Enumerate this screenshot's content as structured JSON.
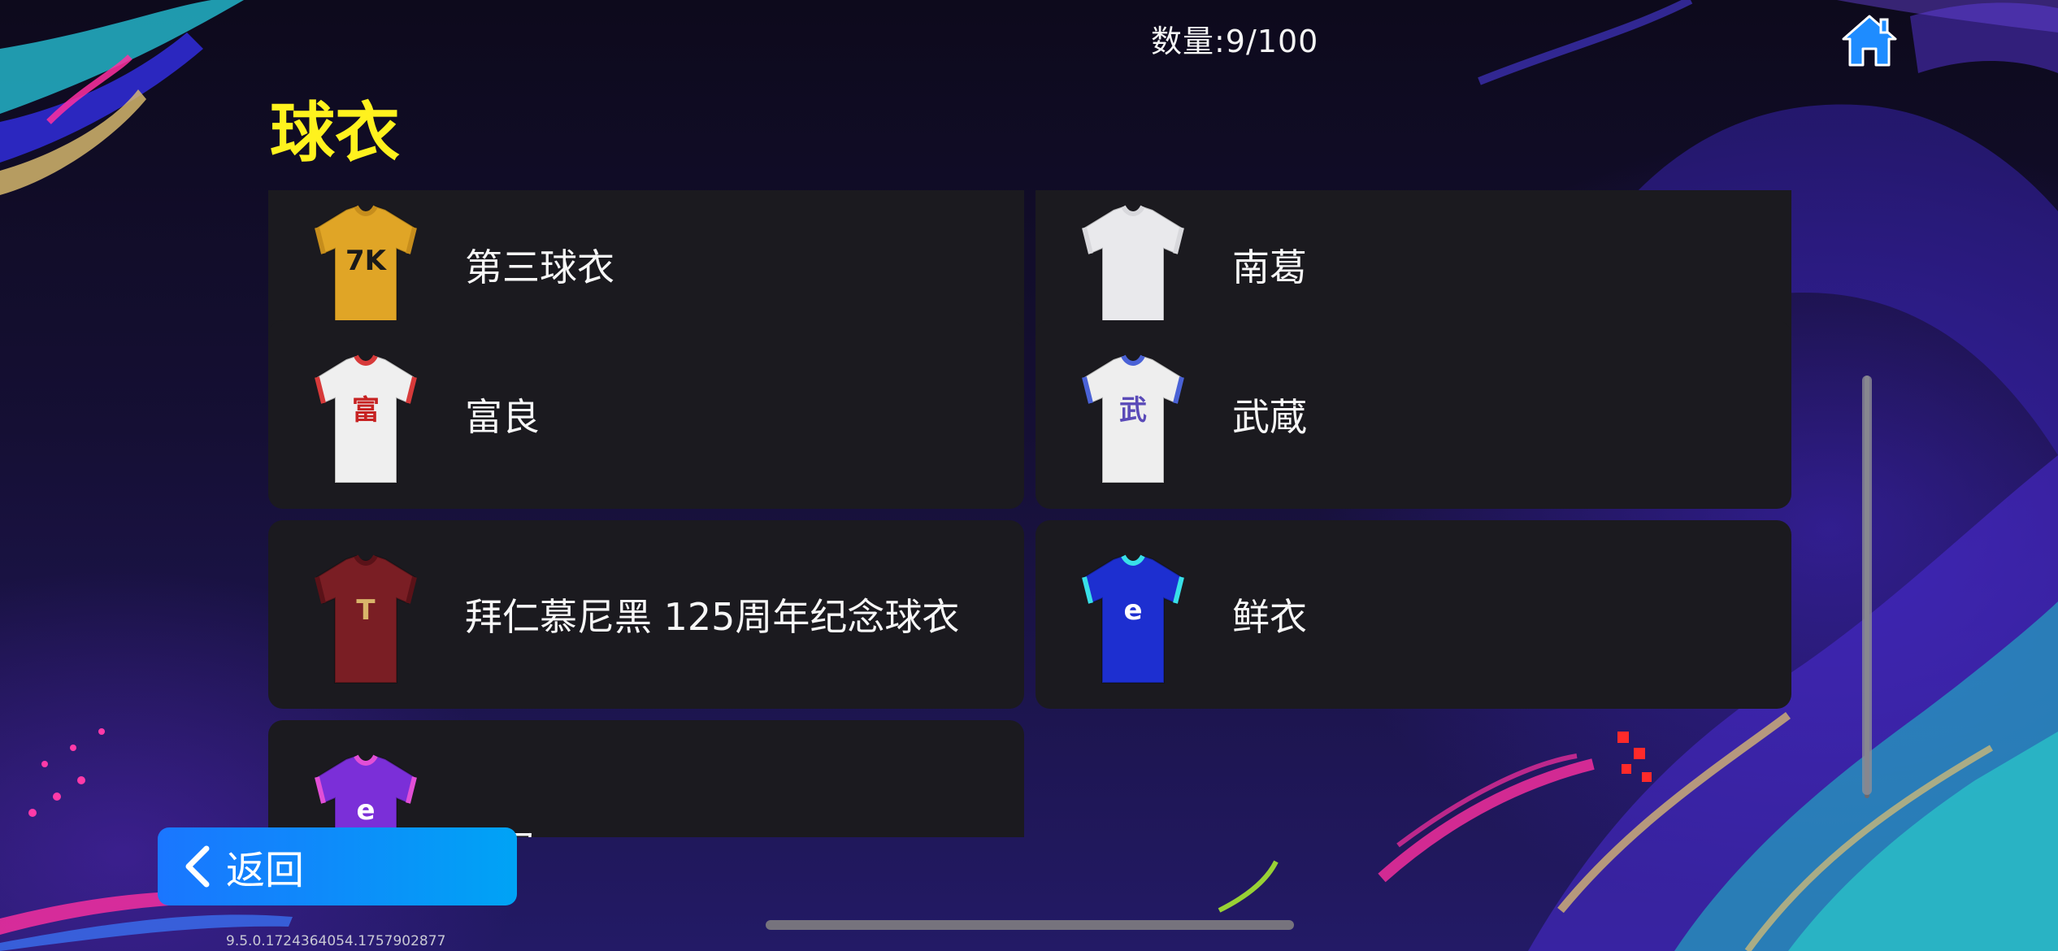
{
  "header": {
    "count_text": "数量:9/100",
    "title": "球衣"
  },
  "items": [
    {
      "label": "第三球衣",
      "jersey": {
        "body": "#e0a526",
        "trim": "#c68d1c",
        "logo": "7K",
        "logo_color": "#1a1a1a"
      }
    },
    {
      "label": "南葛",
      "jersey": {
        "body": "#e9e9ec",
        "trim": "#d8d8dc",
        "logo": "",
        "logo_color": "#6a6a6a"
      }
    },
    {
      "label": "富良",
      "jersey": {
        "body": "#efefef",
        "trim": "#d73a3a",
        "logo": "富",
        "logo_color": "#c72222"
      }
    },
    {
      "label": "武蔵",
      "jersey": {
        "body": "#eeeeee",
        "trim": "#4a62d6",
        "logo": "武",
        "logo_color": "#5a4ab8"
      }
    },
    {
      "label": "拜仁慕尼黑 125周年纪念球衣",
      "jersey": {
        "body": "#7a1e24",
        "trim": "#5a1218",
        "logo": "T",
        "logo_color": "#d9b46a"
      }
    },
    {
      "label": "鲜衣",
      "jersey": {
        "body": "#1d2fd0",
        "trim": "#39e0e8",
        "logo": "e",
        "logo_color": "#ffffff"
      }
    },
    {
      "label": "怒马",
      "jersey": {
        "body": "#7b2fd8",
        "trim": "#e24fd6",
        "logo": "e",
        "logo_color": "#ffffff"
      }
    }
  ],
  "back_button": {
    "label": "返回"
  },
  "version": "9.5.0.1724364054.1757902877",
  "icons": {
    "home": "home-icon",
    "back": "chevron-left-icon"
  },
  "colors": {
    "title": "#fff21e",
    "card": "#1b1a1f",
    "back_button": "#1a76ff",
    "home_icon": "#1e8cff"
  }
}
